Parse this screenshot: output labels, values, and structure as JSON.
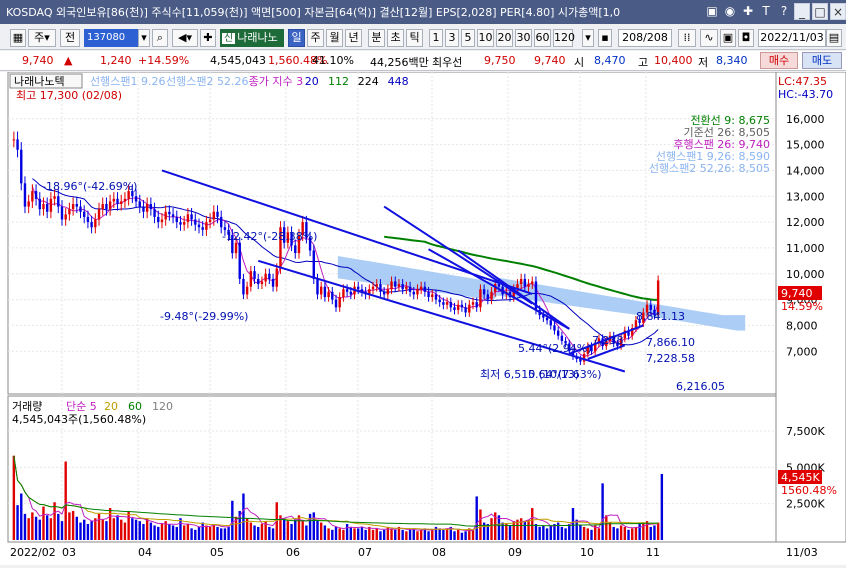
{
  "window": {
    "title": "KOSDAQ 외국인보유[86(천)] 주식수[11,059(천)] 액면[500] 자본금[64(억)] 결산[12월] EPS[2,028] PER[4.80] 시가총액[1,0",
    "icons": [
      "lock-icon",
      "help-icon",
      "pin-icon",
      "font-icon",
      "question-icon",
      "minimize-icon",
      "maximize-icon",
      "close-icon"
    ]
  },
  "toolbar": {
    "prefix_label": "주",
    "all_label": "전",
    "code": "137080",
    "stock_name": "나래나노텍",
    "period_buttons": [
      "일",
      "주",
      "월",
      "년",
      "분",
      "초",
      "틱"
    ],
    "active_period": "일",
    "interval_buttons": [
      "1",
      "3",
      "5",
      "10",
      "20",
      "30",
      "60",
      "120"
    ],
    "count": "208/208",
    "date": "2022/11/03"
  },
  "infobar": {
    "price": "9,740",
    "arrow": "▲",
    "change": "1,240",
    "change_pct": "+14.59%",
    "volume": "4,545,043",
    "volume_pct": "1,560.48%",
    "turnover": "41.10%",
    "amount": "44,256백만",
    "best_sell_label": "최우선",
    "best_sell": "9,750",
    "best_buy": "9,740",
    "open_label": "시",
    "open": "8,470",
    "high_label": "고",
    "high": "10,400",
    "low_label": "저",
    "low": "8,340",
    "buy_label": "매수",
    "sell_label": "매도"
  },
  "price_panel": {
    "name_tag": "나래나노텍",
    "legend": [
      {
        "text": "선행스팬1 9.26",
        "color": "#8ab4f0"
      },
      {
        "text": "선행스팬2 52.26",
        "color": "#8ab4f0"
      },
      {
        "text": "종가 지수 3",
        "color": "#c020c0"
      },
      {
        "text": "20",
        "color": "#0000c0"
      },
      {
        "text": "112",
        "color": "#008000"
      },
      {
        "text": "224",
        "color": "#000000"
      },
      {
        "text": "448",
        "color": "#0000c0"
      }
    ],
    "max_label": "최고 17,300 (02/08)",
    "min_label": "최저 6,510 (10/13)",
    "lc": "LC:47.35",
    "hc": "HC:-43.70",
    "ichimoku": [
      {
        "text": "전환선 9: 8,675",
        "color": "#008000"
      },
      {
        "text": "기준선 26: 8,505",
        "color": "#606060"
      },
      {
        "text": "후행스팬 26: 9,740",
        "color": "#c020c0"
      },
      {
        "text": "선행스팬1 9,26: 8,590",
        "color": "#8ab4f0"
      },
      {
        "text": "선행스팬2 52,26: 8,505",
        "color": "#8ab4f0"
      }
    ],
    "current_price_tag": "9,740",
    "current_pct_tag": "14.59%",
    "annotations": [
      {
        "text": "-18.96°(-42.69%)"
      },
      {
        "text": "-12.42°(-28.38%)"
      },
      {
        "text": "-9.48°(-29.99%)"
      },
      {
        "text": "5.44°(2.94%)"
      },
      {
        "text": "7,238"
      },
      {
        "text": "8,841.13"
      },
      {
        "text": "7,866.10"
      },
      {
        "text": "7,228.58"
      },
      {
        "text": "6,216.05"
      },
      {
        "text": "5.64°(7.63%)"
      }
    ]
  },
  "volume_panel": {
    "title": "거래량",
    "legend": [
      {
        "text": "단순 5",
        "color": "#c020c0"
      },
      {
        "text": "20",
        "color": "#c0a000"
      },
      {
        "text": "60",
        "color": "#008000"
      },
      {
        "text": "120",
        "color": "#808080"
      }
    ],
    "value_label": "4,545,043주(1,560.48%)",
    "value_tag": "4,545K",
    "pct_tag": "1560.48%"
  },
  "chart_data": {
    "type": "candlestick",
    "ylim": [
      5500,
      17500
    ],
    "y_ticks": [
      7000,
      8000,
      9000,
      10000,
      11000,
      12000,
      13000,
      14000,
      15000,
      16000
    ],
    "y_tick_labels": [
      "7,000",
      "8,000",
      "9,000",
      "10,000",
      "11,000",
      "12,000",
      "13,000",
      "14,000",
      "15,000",
      "16,000"
    ],
    "volume_ticks": [
      2500,
      5000,
      7500
    ],
    "volume_tick_labels": [
      "2,500K",
      "5,000K",
      "7,500K"
    ],
    "x_labels": [
      "2022/02",
      "03",
      "04",
      "05",
      "06",
      "07",
      "08",
      "09",
      "10",
      "11",
      "11/03"
    ],
    "close": [
      15200,
      14800,
      13500,
      12600,
      12800,
      13200,
      12900,
      12500,
      12700,
      12400,
      12900,
      13000,
      12600,
      12100,
      12300,
      12500,
      12700,
      12600,
      12400,
      12200,
      12000,
      11800,
      12100,
      12500,
      12700,
      12500,
      12800,
      12900,
      12700,
      12800,
      12900,
      13200,
      13000,
      12800,
      12600,
      12400,
      12700,
      12500,
      12200,
      12000,
      12100,
      12400,
      12300,
      12200,
      12000,
      11900,
      12000,
      12300,
      12100,
      11900,
      11800,
      11700,
      12000,
      12100,
      12400,
      12200,
      11800,
      11700,
      11500,
      10800,
      11200,
      9800,
      9200,
      9500,
      10100,
      9800,
      9600,
      9700,
      10000,
      9800,
      9500,
      10200,
      11800,
      11200,
      11600,
      11100,
      10800,
      11500,
      12000,
      11400,
      10900,
      9800,
      9200,
      9500,
      9100,
      9300,
      9000,
      8700,
      9100,
      9400,
      9300,
      9200,
      9500,
      9400,
      9300,
      9200,
      9400,
      9500,
      9600,
      9300,
      9200,
      9400,
      9700,
      9500,
      9600,
      9400,
      9500,
      9300,
      9200,
      9400,
      9500,
      9300,
      9100,
      9200,
      9000,
      8900,
      8800,
      8900,
      8700,
      8600,
      8800,
      8700,
      8500,
      8800,
      8900,
      8700,
      9400,
      9200,
      9000,
      9300,
      9600,
      9500,
      9200,
      9300,
      9100,
      9400,
      9600,
      9800,
      9500,
      9600,
      9700,
      8600,
      8400,
      8300,
      8200,
      8000,
      7800,
      7600,
      7400,
      7300,
      7000,
      6800,
      6700,
      6600,
      6900,
      7200,
      7000,
      7300,
      7500,
      7200,
      7400,
      7600,
      7300,
      7200,
      7500,
      7800,
      7600,
      7900,
      8200,
      8100,
      8500,
      8800,
      8600,
      8400,
      9740
    ],
    "volume": [
      5800,
      2400,
      3200,
      1800,
      1500,
      1900,
      1600,
      1400,
      2300,
      1700,
      1500,
      2600,
      1800,
      1300,
      5400,
      1900,
      2000,
      1600,
      1200,
      1400,
      1100,
      1300,
      1500,
      1800,
      1400,
      1300,
      2200,
      1500,
      1700,
      1400,
      1200,
      2000,
      1500,
      1400,
      1300,
      1100,
      1500,
      1200,
      1000,
      900,
      1100,
      1300,
      1100,
      1000,
      900,
      1500,
      1000,
      1100,
      800,
      700,
      900,
      1200,
      1000,
      900,
      1100,
      900,
      800,
      800,
      900,
      2700,
      1600,
      2000,
      3200,
      1500,
      1200,
      1000,
      900,
      1100,
      1300,
      900,
      800,
      2600,
      1700,
      1500,
      1300,
      1100,
      1400,
      1700,
      1300,
      1000,
      1800,
      1900,
      1400,
      1200,
      1000,
      800,
      700,
      900,
      800,
      700,
      1100,
      900,
      800,
      800,
      900,
      700,
      900,
      700,
      800,
      600,
      700,
      900,
      800,
      700,
      900,
      700,
      600,
      700,
      800,
      600,
      700,
      800,
      600,
      700,
      900,
      800,
      700,
      800,
      900,
      600,
      700,
      500,
      600,
      800,
      700,
      3000,
      2100,
      1200,
      1100,
      1500,
      1900,
      1700,
      1200,
      1100,
      1000,
      1300,
      1400,
      1500,
      1300,
      1400,
      2200,
      1100,
      900,
      1000,
      800,
      1000,
      1100,
      1200,
      900,
      800,
      1100,
      2200,
      1400,
      1000,
      900,
      800,
      700,
      1000,
      800,
      3900,
      1700,
      1200,
      900,
      800,
      1000,
      900,
      700,
      800,
      900,
      1100,
      1200,
      1300,
      900,
      1000,
      1200,
      4545
    ],
    "mas": {
      "ma20": true,
      "ma112": true,
      "ma224": true
    }
  }
}
